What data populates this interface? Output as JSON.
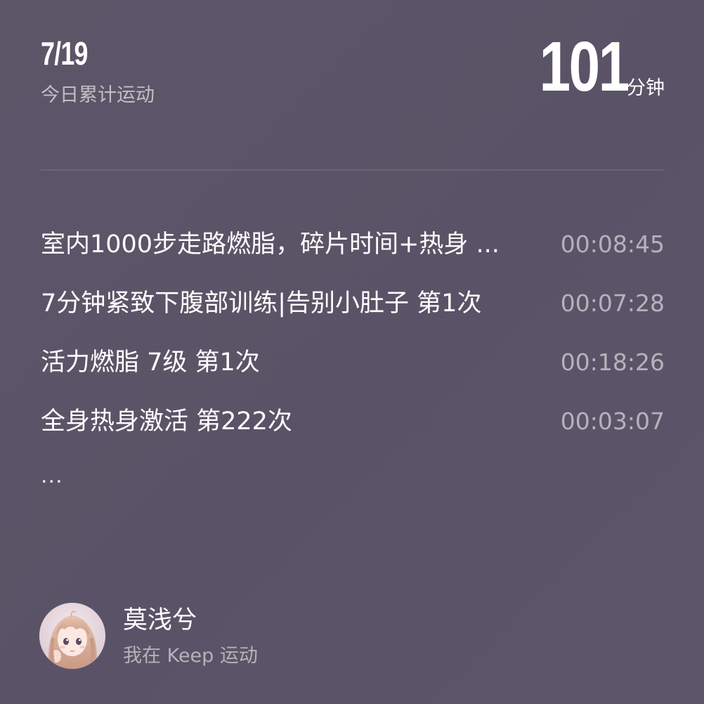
{
  "header": {
    "date": "7/19",
    "subtitle": "今日累计运动",
    "total_value": "101",
    "total_unit": "分钟"
  },
  "records": [
    {
      "name": "室内1000步走路燃脂，碎片时间+热身 ...",
      "duration": "00:08:45"
    },
    {
      "name": "7分钟紧致下腹部训练|告别小肚子 第1次",
      "duration": "00:07:28"
    },
    {
      "name": "活力燃脂 7级 第1次",
      "duration": "00:18:26"
    },
    {
      "name": "全身热身激活 第222次",
      "duration": "00:03:07"
    }
  ],
  "more_indicator": "...",
  "user": {
    "name": "莫浅兮",
    "note": "我在 Keep 运动",
    "avatar_icon": "anime-girl-avatar"
  },
  "colors": {
    "background": "#5b5369",
    "text_primary": "#ffffff",
    "text_secondary": "rgba(255,255,255,0.55)"
  }
}
